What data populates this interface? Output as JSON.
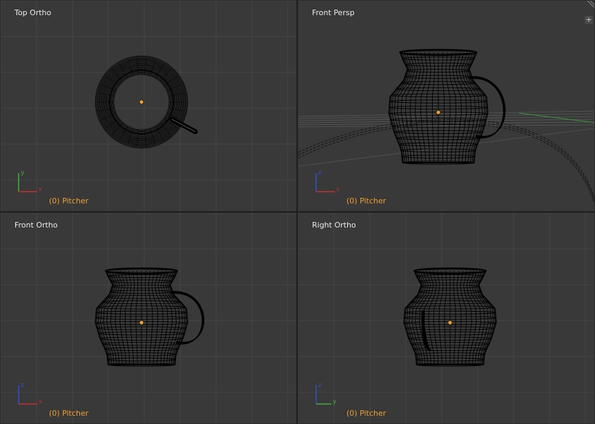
{
  "viewports": {
    "top_left": {
      "view": "Top Ortho",
      "object": "(0) Pitcher",
      "axis_labels": [
        "y",
        "x"
      ]
    },
    "top_right": {
      "view": "Front Persp",
      "object": "(0) Pitcher",
      "axis_labels": [
        "z",
        "x"
      ]
    },
    "bottom_left": {
      "view": "Front Ortho",
      "object": "(0) Pitcher",
      "axis_labels": [
        "z",
        "x"
      ]
    },
    "bottom_right": {
      "view": "Right Ortho",
      "object": "(0) Pitcher",
      "axis_labels": [
        "z",
        "y"
      ]
    }
  },
  "colors": {
    "viewport_bg": "#393939",
    "grid": "#454545",
    "wire": "#000000",
    "origin": "#f0a030",
    "object_label": "#f0a030",
    "axis_x": "#c83030",
    "axis_y": "#40b040",
    "axis_z": "#3050d0"
  },
  "icons": {
    "corner_button": "plus-icon",
    "corner_hatch": "split-handle-icon"
  }
}
